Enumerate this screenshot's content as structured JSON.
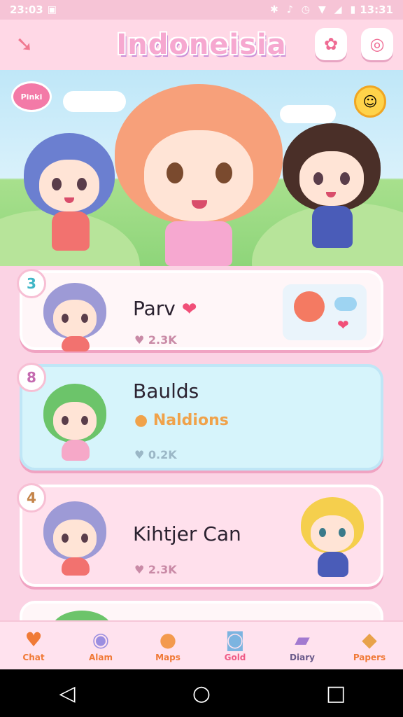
{
  "status_bar": {
    "time": "23:03",
    "right_time": "13:31",
    "icons": [
      "bluetooth-icon",
      "mute-icon",
      "alarm-icon",
      "wifi-icon",
      "signal-icon",
      "battery-icon"
    ]
  },
  "header": {
    "title": "Indoneisia",
    "back_icon": "back-arrow-icon",
    "badge_icon": "flower-badge-icon",
    "chat_icon": "chat-icon"
  },
  "hero": {
    "bubble_text": "Pinki",
    "sun_icon": "sun-face-icon"
  },
  "cards": [
    {
      "badge": "3",
      "name": "Parv",
      "meta": "2.3K",
      "color": "#fff6f8"
    },
    {
      "badge": "8",
      "name": "Baulds",
      "sub": "Naldions",
      "meta": "0.2K",
      "color": "#d6f4fb"
    },
    {
      "badge": "4",
      "name": "Kihtjer Can",
      "meta": "2.3K",
      "color": "#ffe0ec"
    }
  ],
  "nav": [
    {
      "label": "Chat",
      "icon": "heart-icon"
    },
    {
      "label": "Alam",
      "icon": "chat-bubble-icon"
    },
    {
      "label": "Maps",
      "icon": "balloon-icon"
    },
    {
      "label": "Gold",
      "icon": "camera-icon"
    },
    {
      "label": "Diary",
      "icon": "book-icon"
    },
    {
      "label": "Papers",
      "icon": "box-icon"
    }
  ],
  "colors": {
    "accent_pink": "#f14f78",
    "accent_orange": "#f07a37",
    "background": "#fbd3e4"
  }
}
